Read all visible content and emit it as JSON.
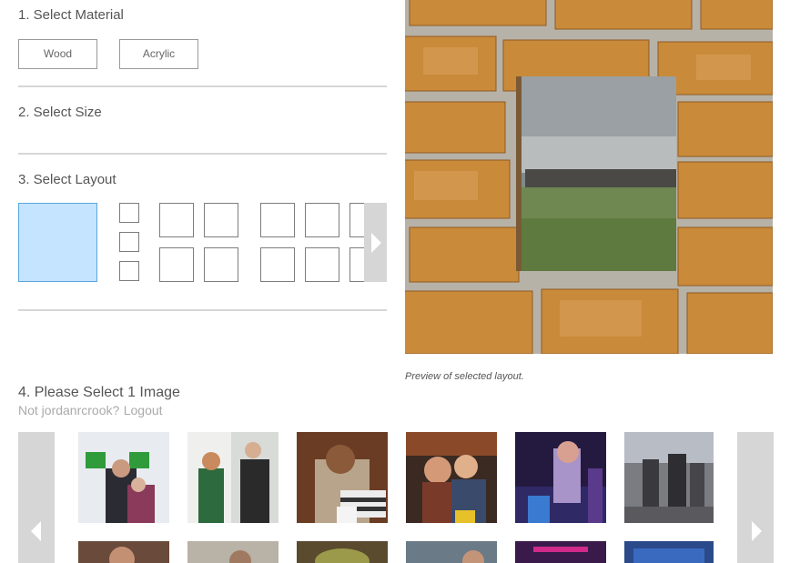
{
  "steps": {
    "material": {
      "title": "1. Select Material",
      "options": [
        "Wood",
        "Acrylic"
      ]
    },
    "size": {
      "title": "2. Select Size"
    },
    "layout": {
      "title": "3. Select Layout"
    },
    "image": {
      "title": "4. Please Select 1 Image",
      "not_user": "Not jordanrcrook?",
      "logout": "Logout"
    }
  },
  "preview": {
    "caption": "Preview of selected layout."
  },
  "icons": {
    "layout_next": "chevron-right-icon",
    "gallery_prev": "chevron-left-icon",
    "gallery_next": "chevron-right-icon"
  },
  "colors": {
    "selected_layout": "#c4e4ff",
    "selected_border": "#5aa7dd",
    "arrow_bg": "#d6d6d6",
    "divider": "#d6d6d6"
  }
}
